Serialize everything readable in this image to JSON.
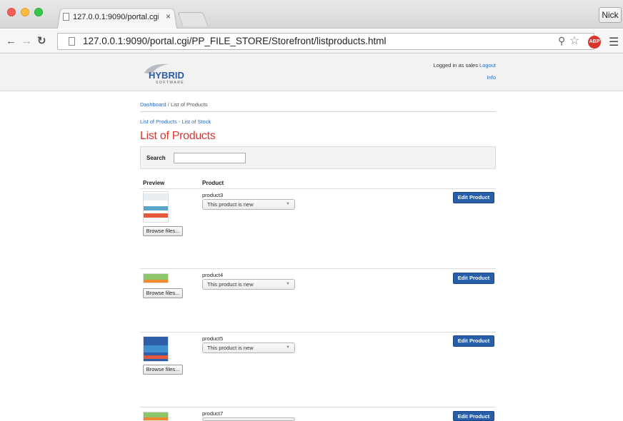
{
  "browser": {
    "tab_title": "127.0.0.1:9090/portal.cgi/F",
    "tab_close": "×",
    "user_button": "Nick",
    "url": "127.0.0.1:9090/portal.cgi/PP_FILE_STORE/Storefront/listproducts.html",
    "abp_label": "ABP",
    "icons": [
      "back-arrow-icon",
      "forward-arrow-icon",
      "reload-icon",
      "page-icon",
      "zoom-icon",
      "star-icon",
      "adblock-icon",
      "menu-icon"
    ]
  },
  "header": {
    "logo_text": "HYBRID",
    "logo_subtext": "SOFTWARE",
    "logged_in_text": "Logged in as sales",
    "logout_label": "Logout",
    "info_label": "Info"
  },
  "breadcrumb": {
    "home": "Dashboard",
    "separator": " / ",
    "current": "List of Products"
  },
  "sublinks": {
    "products": "List of Products",
    "separator": " - ",
    "stock": "List of Stock"
  },
  "page_title": "List of Products",
  "search": {
    "label": "Search",
    "value": "",
    "placeholder": ""
  },
  "table": {
    "headers": {
      "preview": "Preview",
      "product": "Product"
    },
    "rows": [
      {
        "name": "product3",
        "status": "This product is new",
        "browse_label": "Browse files...",
        "edit_label": "Edit Product",
        "thumb_colors": [
          "#e9eef2",
          "#e55a3c",
          "#5aa6c8"
        ]
      },
      {
        "name": "product4",
        "status": "This product is new",
        "browse_label": "Browse files...",
        "edit_label": "Edit Product",
        "thumb_colors": [
          "#8cc56a",
          "#f08a2c",
          "#e9eef2"
        ]
      },
      {
        "name": "product5",
        "status": "This product is new",
        "browse_label": "Browse files...",
        "edit_label": "Edit Product",
        "thumb_colors": [
          "#2c5fa8",
          "#3f8fd0",
          "#e55a3c"
        ]
      },
      {
        "name": "product7",
        "status": "This product is new",
        "browse_label": "Browse files...",
        "edit_label": "Edit Product",
        "thumb_colors": [
          "#8cc56a",
          "#f08a2c",
          "#e9eef2"
        ]
      }
    ]
  },
  "colors": {
    "accent_red": "#d9352f",
    "link_blue": "#2a6ab8",
    "button_blue": "#285ea8"
  }
}
